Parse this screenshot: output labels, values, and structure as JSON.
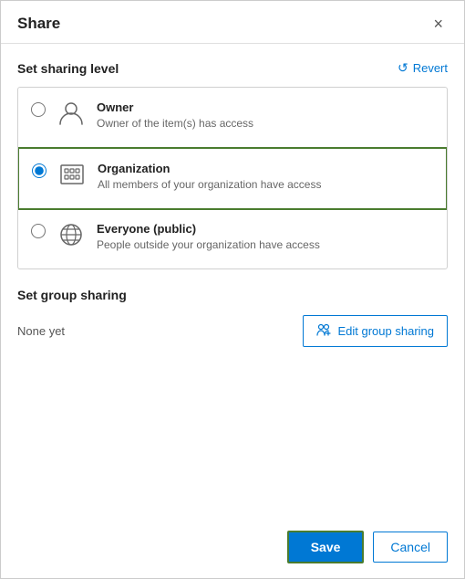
{
  "dialog": {
    "title": "Share",
    "close_label": "×"
  },
  "sharing_level": {
    "section_title": "Set sharing level",
    "revert_label": "Revert",
    "options": [
      {
        "id": "owner",
        "label": "Owner",
        "description": "Owner of the item(s) has access",
        "selected": false,
        "icon": "person-icon"
      },
      {
        "id": "organization",
        "label": "Organization",
        "description": "All members of your organization have access",
        "selected": true,
        "icon": "org-icon"
      },
      {
        "id": "everyone",
        "label": "Everyone (public)",
        "description": "People outside your organization have access",
        "selected": false,
        "icon": "globe-icon"
      }
    ]
  },
  "group_sharing": {
    "section_title": "Set group sharing",
    "none_yet_label": "None yet",
    "edit_button_label": "Edit group sharing"
  },
  "footer": {
    "save_label": "Save",
    "cancel_label": "Cancel"
  }
}
